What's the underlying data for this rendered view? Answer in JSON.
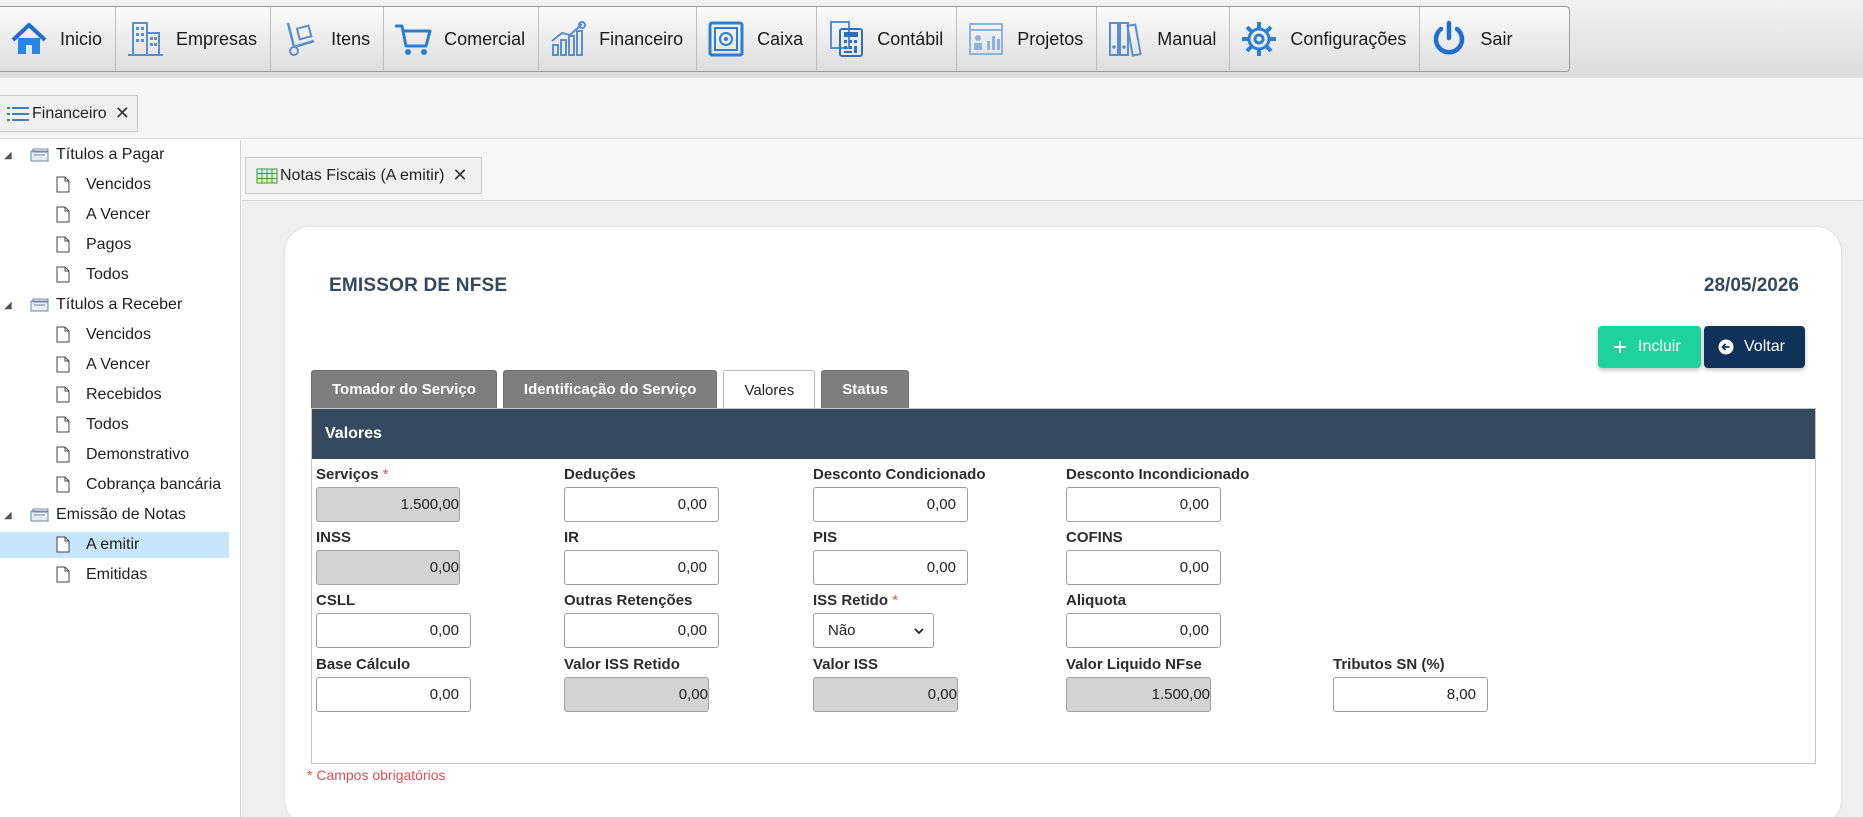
{
  "menu": [
    {
      "label": "Inicio",
      "icon": "home-icon"
    },
    {
      "label": "Empresas",
      "icon": "buildings-icon"
    },
    {
      "label": "Itens",
      "icon": "hand-truck-icon"
    },
    {
      "label": "Comercial",
      "icon": "cart-icon"
    },
    {
      "label": "Financeiro",
      "icon": "chart-growth-icon"
    },
    {
      "label": "Caixa",
      "icon": "safe-icon"
    },
    {
      "label": "Contábil",
      "icon": "calculator-icon"
    },
    {
      "label": "Projetos",
      "icon": "project-board-icon"
    },
    {
      "label": "Manual",
      "icon": "binders-icon"
    },
    {
      "label": "Configurações",
      "icon": "gear-icon"
    },
    {
      "label": "Sair",
      "icon": "power-icon"
    }
  ],
  "module_tab": {
    "label": "Financeiro",
    "close": "✕"
  },
  "sidebar": {
    "groups": [
      {
        "label": "Títulos a Pagar",
        "items": [
          "Vencidos",
          "A Vencer",
          "Pagos",
          "Todos"
        ]
      },
      {
        "label": "Títulos a Receber",
        "items": [
          "Vencidos",
          "A Vencer",
          "Recebidos",
          "Todos",
          "Demonstrativo",
          "Cobrança bancária"
        ]
      },
      {
        "label": "Emissão de Notas",
        "items": [
          "A emitir",
          "Emitidas"
        ]
      }
    ],
    "selected": "A emitir"
  },
  "sub_tab": {
    "label": "Notas Fiscais (A emitir)",
    "close": "✕"
  },
  "page": {
    "title": "EMISSOR DE NFSE",
    "date": "28/05/2026",
    "buttons": {
      "incluir": "Incluir",
      "voltar": "Voltar"
    },
    "tabs": [
      "Tomador do Serviço",
      "Identificação do Serviço",
      "Valores",
      "Status"
    ],
    "active_tab": "Valores",
    "panel_title": "Valores",
    "required_note": "* Campos obrigatórios"
  },
  "fields": {
    "servicos": {
      "label": "Serviços",
      "value": "1.500,00",
      "required_mark": "*"
    },
    "deducoes": {
      "label": "Deduções",
      "value": "0,00"
    },
    "desconto_condicionado": {
      "label": "Desconto Condicionado",
      "value": "0,00"
    },
    "desconto_incondicionado": {
      "label": "Desconto Incondicionado",
      "value": "0,00"
    },
    "inss": {
      "label": "INSS",
      "value": "0,00"
    },
    "ir": {
      "label": "IR",
      "value": "0,00"
    },
    "pis": {
      "label": "PIS",
      "value": "0,00"
    },
    "cofins": {
      "label": "COFINS",
      "value": "0,00"
    },
    "csll": {
      "label": "CSLL",
      "value": "0,00"
    },
    "outras_retencoes": {
      "label": "Outras Retenções",
      "value": "0,00"
    },
    "iss_retido": {
      "label": "ISS Retido",
      "value": "Não",
      "required_mark": "*"
    },
    "aliquota": {
      "label": "Aliquota",
      "value": "0,00"
    },
    "base_calculo": {
      "label": "Base Cálculo",
      "value": "0,00"
    },
    "valor_iss_retido": {
      "label": "Valor ISS Retido",
      "value": "0,00"
    },
    "valor_iss": {
      "label": "Valor ISS",
      "value": "0,00"
    },
    "valor_liquido": {
      "label": "Valor Liquido NFse",
      "value": "1.500,00"
    },
    "tributos_sn": {
      "label": "Tributos SN (%)",
      "value": "8,00"
    }
  },
  "colors": {
    "accent_green": "#1ed39b",
    "navy": "#0f3358",
    "panel_header": "#354a5f",
    "selected_row": "#c7e6fb",
    "required": "#d9534f"
  }
}
